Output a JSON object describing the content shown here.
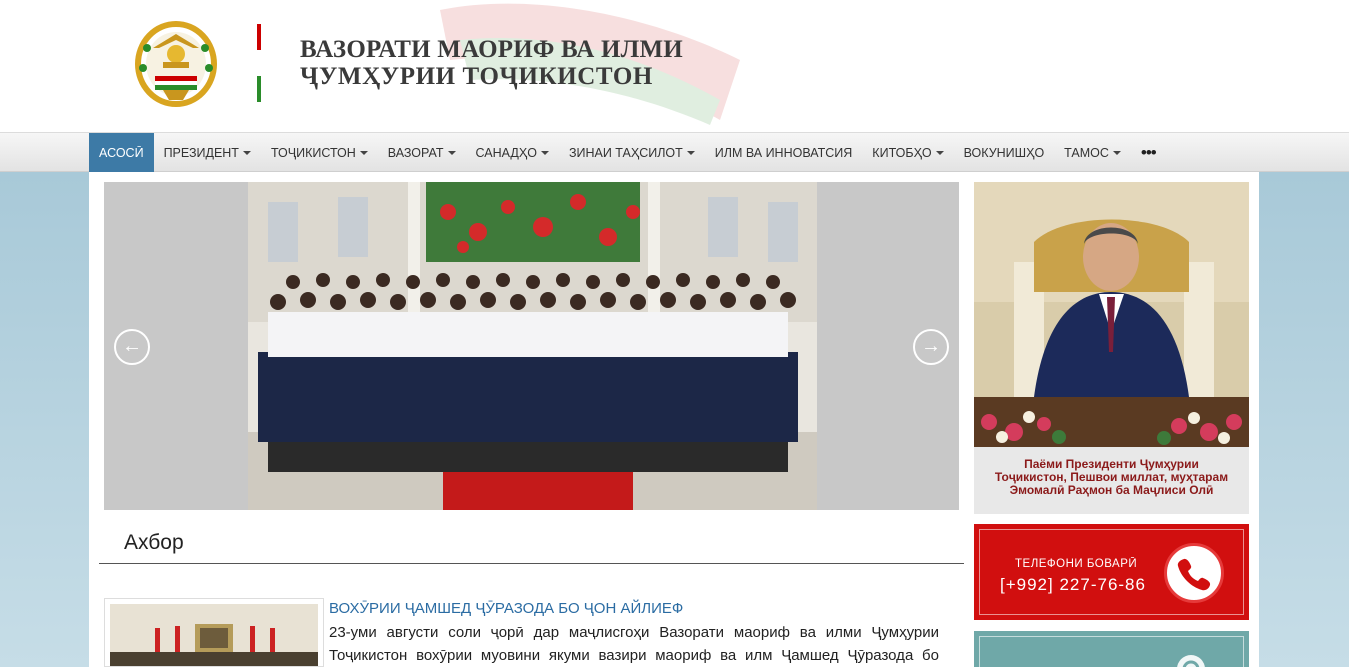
{
  "header": {
    "title_line1": "ВАЗОРАТИ МАОРИФ ВА ИЛМИ",
    "title_line2": "ҶУМҲУРИИ ТОҶИКИСТОН",
    "emblem_icon": "tajikistan-emblem-icon"
  },
  "nav": {
    "items": [
      {
        "label": "АСОСӢ",
        "active": true,
        "dropdown": false
      },
      {
        "label": "ПРЕЗИДЕНТ",
        "dropdown": true
      },
      {
        "label": "ТОҶИКИСТОН",
        "dropdown": true
      },
      {
        "label": "ВАЗОРАТ",
        "dropdown": true
      },
      {
        "label": "САНАДҲО",
        "dropdown": true
      },
      {
        "label": "ЗИНАИ ТАҲСИЛОТ",
        "dropdown": true
      },
      {
        "label": "ИЛМ ВА ИННОВАТСИЯ",
        "dropdown": false
      },
      {
        "label": "КИТОБҲО",
        "dropdown": true
      },
      {
        "label": "ВОКУНИШҲО",
        "dropdown": false
      },
      {
        "label": "ТАМОС",
        "dropdown": true
      }
    ],
    "more_label": "•••"
  },
  "slider": {
    "prev_arrow": "←",
    "next_arrow": "→"
  },
  "news": {
    "section_title": "Ахбор",
    "headline": "ВОХӮРИИ ҶАМШЕД ҶӮРАЗОДА БО ҶОН АЙЛИЕФ",
    "body_line1": "23-уми августи соли ҷорӣ дар маҷлисгоҳи Вазорати маориф ва илми Ҷумҳурии",
    "body_line2": "Тоҷикистон вохӯрии муовини якуми вазири маориф ва илм Ҷамшед Ҷӯразода бо"
  },
  "sidebar": {
    "president_caption_l1": "Паёми Президенти Ҷумҳурии",
    "president_caption_l2": "Тоҷикистон, Пешвои миллат, муҳтарам",
    "president_caption_l3": "Эмомалӣ Раҳмон ба Маҷлиси Олӣ",
    "trust_label": "ТЕЛЕФОНИ БОВАРӢ",
    "trust_phone": "[+992] 227-76-86"
  },
  "colors": {
    "nav_active": "#3d7aa6",
    "trust_red": "#d10f0f",
    "headline_blue": "#2b6ca3",
    "caption_red": "#8b1a1a"
  }
}
